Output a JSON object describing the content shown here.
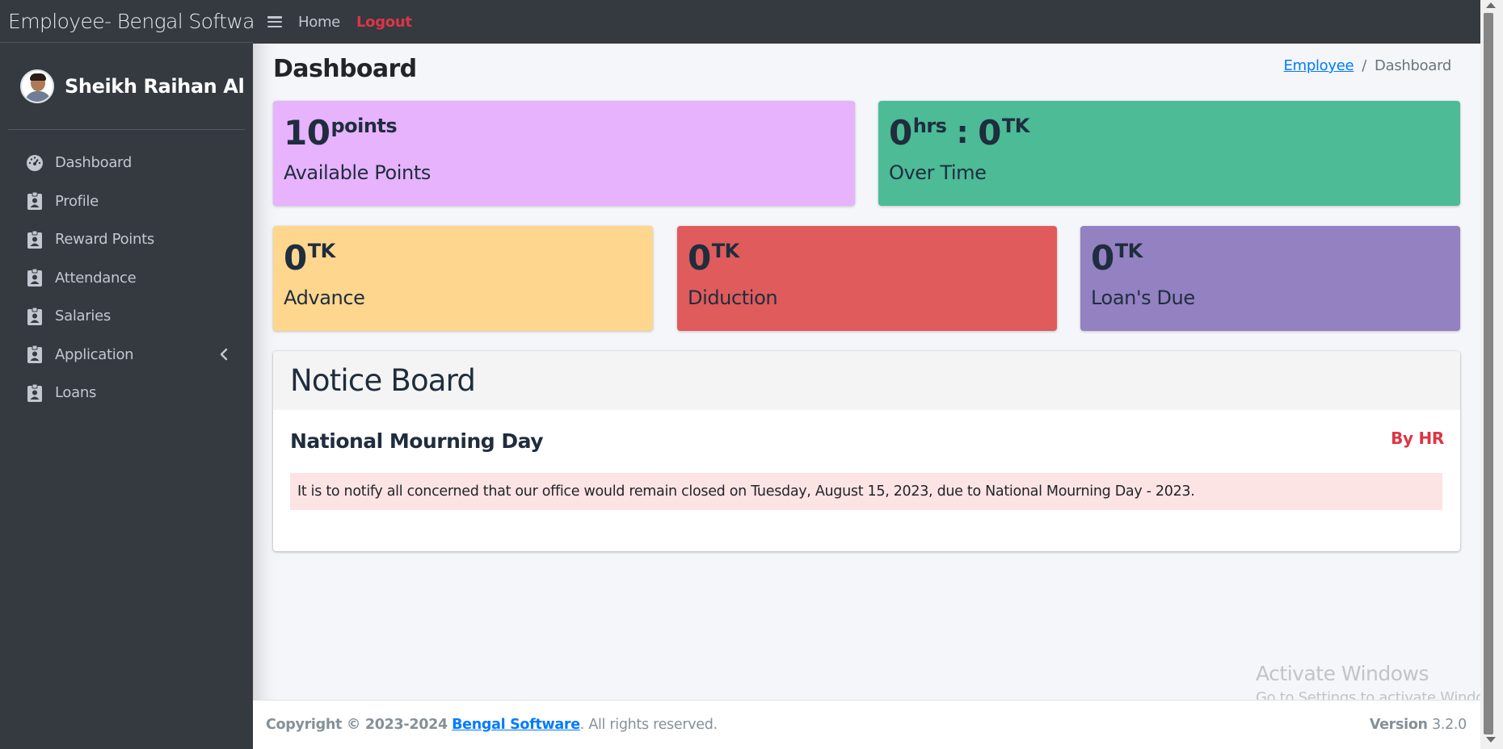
{
  "brand": {
    "title": "Employee- Bengal Software"
  },
  "user": {
    "name": "Sheikh Raihan Al Sa"
  },
  "sidebar": {
    "items": [
      {
        "label": "Dashboard",
        "icon": "tachometer-icon"
      },
      {
        "label": "Profile",
        "icon": "id-badge-icon"
      },
      {
        "label": "Reward Points",
        "icon": "id-badge-icon"
      },
      {
        "label": "Attendance",
        "icon": "id-badge-icon"
      },
      {
        "label": "Salaries",
        "icon": "id-badge-icon"
      },
      {
        "label": "Application",
        "icon": "id-badge-icon",
        "has_submenu": true
      },
      {
        "label": "Loans",
        "icon": "id-badge-icon"
      }
    ]
  },
  "topbar": {
    "home": "Home",
    "logout": "Logout"
  },
  "page": {
    "title": "Dashboard"
  },
  "breadcrumb": {
    "parent": "Employee",
    "separator": "/",
    "current": "Dashboard"
  },
  "stats": {
    "points": {
      "value": "10",
      "unit": "points",
      "label": "Available Points",
      "color": "#e6b3fc"
    },
    "overtime": {
      "hours": "0",
      "hours_unit": "hrs",
      "separator": ":",
      "amount": "0",
      "amount_unit": "TK",
      "label": "Over Time",
      "color": "#4cbb96"
    },
    "advance": {
      "value": "0",
      "unit": "TK",
      "label": "Advance",
      "color": "#fed68e"
    },
    "deduction": {
      "value": "0",
      "unit": "TK",
      "label": "Diduction",
      "color": "#df5b5c"
    },
    "loans_due": {
      "value": "0",
      "unit": "TK",
      "label": "Loan's Due",
      "color": "#9381c2"
    }
  },
  "notice_board": {
    "title": "Notice Board",
    "notices": [
      {
        "title": "National Mourning Day",
        "author": "By HR",
        "body": "It is to notify all concerned that our office would remain closed on Tuesday, August 15, 2023, due to National Mourning Day - 2023."
      }
    ]
  },
  "footer": {
    "copyright": "Copyright © 2023-2024",
    "company": "Bengal Software",
    "rights": ". All rights reserved.",
    "version_label": "Version",
    "version": "3.2.0"
  },
  "watermark": {
    "title": "Activate Windows",
    "subtitle": "Go to Settings to activate Windows."
  }
}
